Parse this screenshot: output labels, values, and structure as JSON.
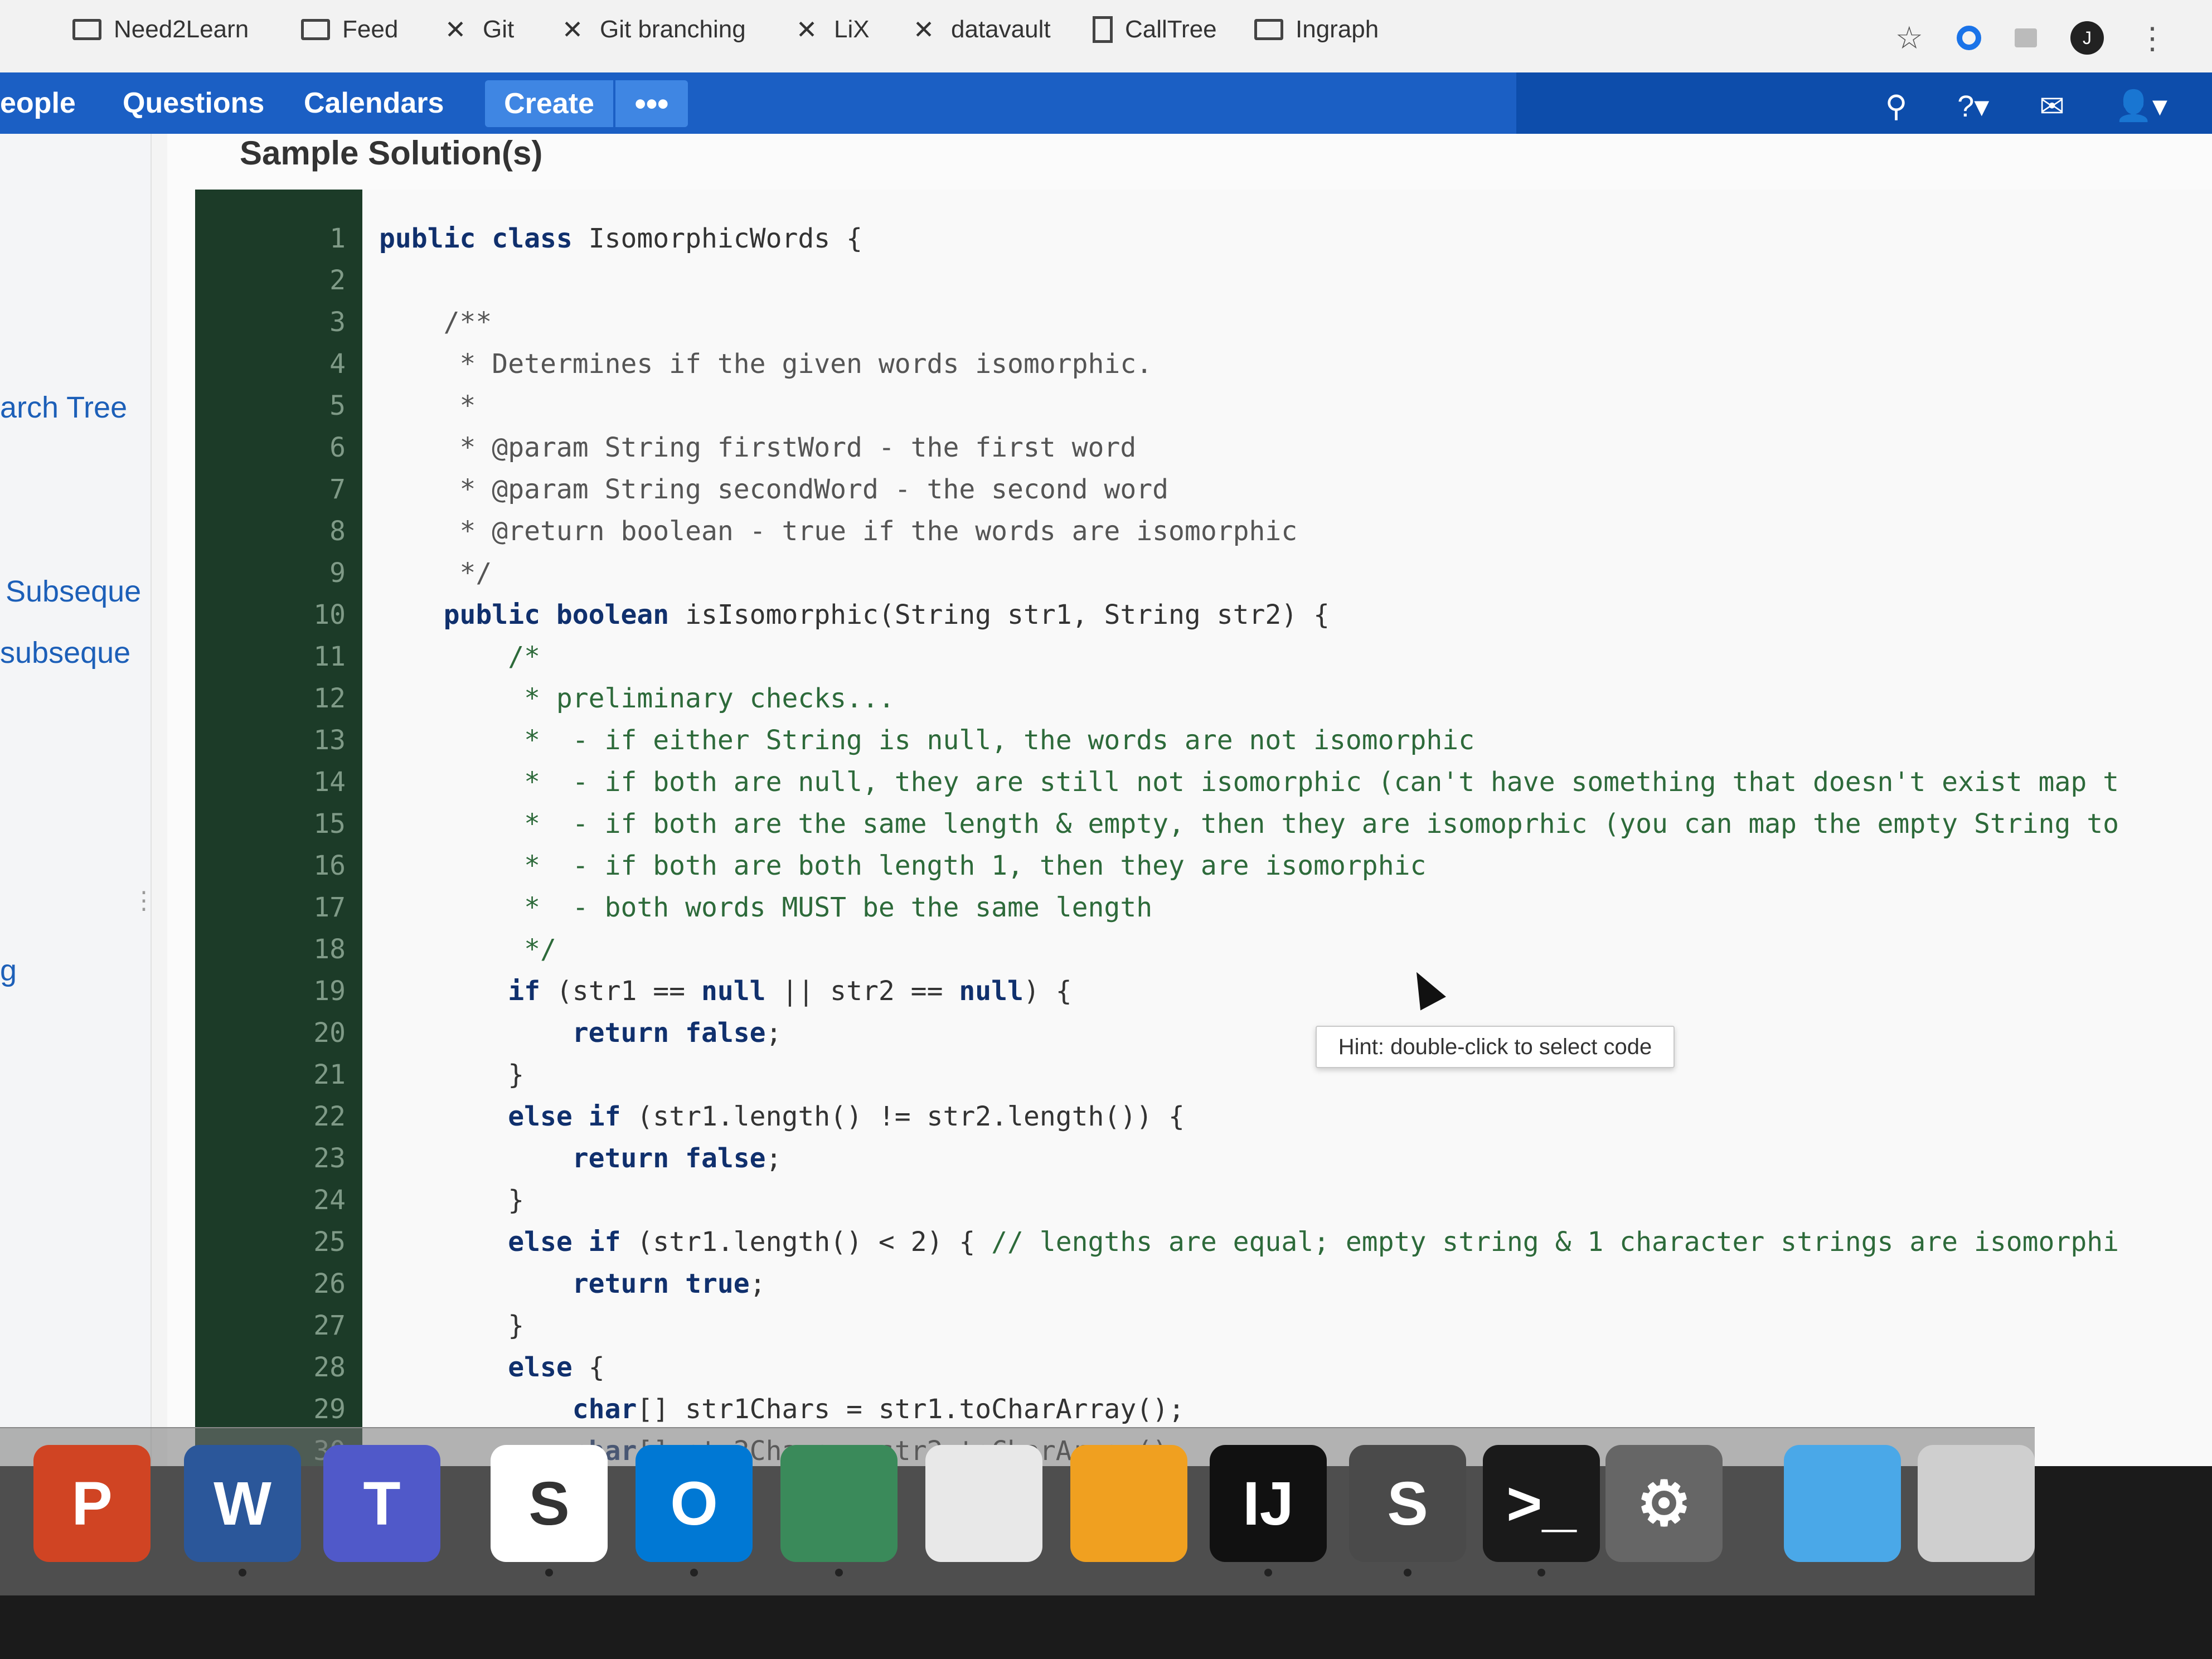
{
  "browser": {
    "bookmarks": [
      {
        "label": "Need2Learn",
        "icon": "folder-icon"
      },
      {
        "label": "Feed",
        "icon": "folder-icon"
      },
      {
        "label": "Git",
        "icon": "tools-icon"
      },
      {
        "label": "Git branching",
        "icon": "tools-icon"
      },
      {
        "label": "LiX",
        "icon": "tools-icon"
      },
      {
        "label": "datavault",
        "icon": "tools-icon"
      },
      {
        "label": "CallTree",
        "icon": "page-icon"
      },
      {
        "label": "Ingraph",
        "icon": "folder-icon"
      }
    ],
    "profile_initial": "J"
  },
  "nav": {
    "items": [
      "eople",
      "Questions",
      "Calendars"
    ],
    "create_label": "Create",
    "more_label": "•••"
  },
  "sidebar": {
    "links": [
      "arch Tree",
      "Subseque",
      "subseque",
      "g"
    ],
    "collapse_label": "«"
  },
  "page": {
    "title": "Sample Solution(s)",
    "tooltip": "Hint: double-click to select code"
  },
  "code": {
    "line_numbers": [
      "1",
      "2",
      "3",
      "4",
      "5",
      "6",
      "7",
      "8",
      "9",
      "10",
      "11",
      "12",
      "13",
      "14",
      "15",
      "16",
      "17",
      "18",
      "19",
      "20",
      "21",
      "22",
      "23",
      "24",
      "25",
      "26",
      "27",
      "28",
      "29",
      "30"
    ],
    "lines": [
      [
        {
          "t": "public class ",
          "c": "kw"
        },
        {
          "t": "IsomorphicWords {",
          "c": ""
        }
      ],
      [],
      [
        {
          "t": "    /**",
          "c": "cm"
        }
      ],
      [
        {
          "t": "     * Determines if the given words isomorphic.",
          "c": "cm"
        }
      ],
      [
        {
          "t": "     *",
          "c": "cm"
        }
      ],
      [
        {
          "t": "     * @param String firstWord - the first word",
          "c": "cm"
        }
      ],
      [
        {
          "t": "     * @param String secondWord - the second word",
          "c": "cm"
        }
      ],
      [
        {
          "t": "     * @return boolean - true if the words are isomorphic",
          "c": "cm"
        }
      ],
      [
        {
          "t": "     */",
          "c": "cm"
        }
      ],
      [
        {
          "t": "    public boolean ",
          "c": "kw"
        },
        {
          "t": "isIsomorphic(String str1, String str2) {",
          "c": ""
        }
      ],
      [
        {
          "t": "        /*",
          "c": "gc"
        }
      ],
      [
        {
          "t": "         * preliminary checks...",
          "c": "gc"
        }
      ],
      [
        {
          "t": "         *  - if either String is null, the words are not isomorphic",
          "c": "gc"
        }
      ],
      [
        {
          "t": "         *  - if both are null, they are still not isomorphic (can't have something that doesn't exist map t",
          "c": "gc"
        }
      ],
      [
        {
          "t": "         *  - if both are the same length & empty, then they are isomoprhic (you can map the empty String to",
          "c": "gc"
        }
      ],
      [
        {
          "t": "         *  - if both are both length 1, then they are isomorphic",
          "c": "gc"
        }
      ],
      [
        {
          "t": "         *  - both words MUST be the same length",
          "c": "gc"
        }
      ],
      [
        {
          "t": "         */",
          "c": "gc"
        }
      ],
      [
        {
          "t": "        if ",
          "c": "kw"
        },
        {
          "t": "(str1 == ",
          "c": ""
        },
        {
          "t": "null",
          "c": "kw"
        },
        {
          "t": " || str2 == ",
          "c": ""
        },
        {
          "t": "null",
          "c": "kw"
        },
        {
          "t": ") {",
          "c": ""
        }
      ],
      [
        {
          "t": "            return false",
          "c": "kw"
        },
        {
          "t": ";",
          "c": ""
        }
      ],
      [
        {
          "t": "        }",
          "c": ""
        }
      ],
      [
        {
          "t": "        else if ",
          "c": "kw"
        },
        {
          "t": "(str1.length() != str2.length()) {",
          "c": ""
        }
      ],
      [
        {
          "t": "            return false",
          "c": "kw"
        },
        {
          "t": ";",
          "c": ""
        }
      ],
      [
        {
          "t": "        }",
          "c": ""
        }
      ],
      [
        {
          "t": "        else if ",
          "c": "kw"
        },
        {
          "t": "(str1.length() < 2) { ",
          "c": ""
        },
        {
          "t": "// lengths are equal; empty string & 1 character strings are isomorphi",
          "c": "gc"
        }
      ],
      [
        {
          "t": "            return true",
          "c": "kw"
        },
        {
          "t": ";",
          "c": ""
        }
      ],
      [
        {
          "t": "        }",
          "c": ""
        }
      ],
      [
        {
          "t": "        else ",
          "c": "kw"
        },
        {
          "t": "{",
          "c": ""
        }
      ],
      [
        {
          "t": "            char",
          "c": "kw"
        },
        {
          "t": "[] str1Chars = str1.toCharArray();",
          "c": ""
        }
      ],
      [
        {
          "t": "            char",
          "c": "kw"
        },
        {
          "t": "[] str2Chars = str2.toCharArray();",
          "c": ""
        }
      ]
    ]
  },
  "dock": {
    "apps": [
      {
        "name": "powerpoint-icon",
        "letter": "P",
        "color": "#d04423"
      },
      {
        "name": "word-icon",
        "letter": "W",
        "color": "#2b579a"
      },
      {
        "name": "teams-icon",
        "letter": "T",
        "color": "#5059c9"
      },
      {
        "name": "slack-icon",
        "letter": "S",
        "color": "#ffffff"
      },
      {
        "name": "outlook-icon",
        "letter": "O",
        "color": "#0078d4"
      },
      {
        "name": "vpn-icon",
        "letter": "",
        "color": "#3a8a5a"
      },
      {
        "name": "wifi-icon",
        "letter": "",
        "color": "#e8e8e8"
      },
      {
        "name": "appstore-icon",
        "letter": "",
        "color": "#f0a020"
      },
      {
        "name": "intellij-icon",
        "letter": "IJ",
        "color": "#111111"
      },
      {
        "name": "sublime-icon",
        "letter": "S",
        "color": "#4a4a4a"
      },
      {
        "name": "terminal-icon",
        "letter": ">_",
        "color": "#1a1a1a"
      },
      {
        "name": "preferences-icon",
        "letter": "⚙",
        "color": "#666666"
      },
      {
        "name": "downloads-icon",
        "letter": "",
        "color": "#4aa8e8"
      },
      {
        "name": "trash-icon",
        "letter": "",
        "color": "#cfcfcf"
      }
    ]
  }
}
